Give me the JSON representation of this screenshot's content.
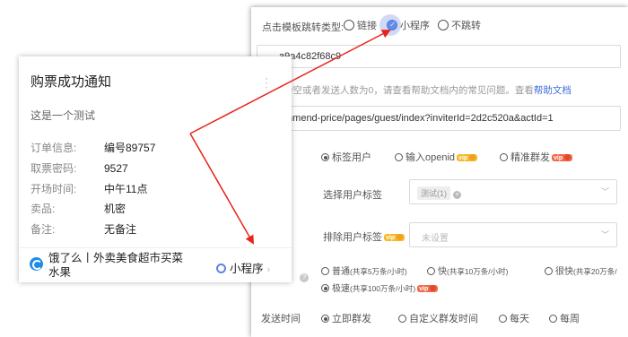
{
  "panel": {
    "jump_type": {
      "label": "点击模板跳转类型:",
      "options": [
        "链接",
        "小程序",
        "不跳转"
      ],
      "selected": "小程序"
    },
    "appid_value": "a9a4c82f68c9",
    "hint": {
      "text": "为空或者发送人数为0，请查看帮助文档内的常见问题。查看",
      "link": "帮助文档"
    },
    "path_value": "mmend-price/pages/guest/index?inviterId=2d2c520a&actId=1",
    "target_type": {
      "options": [
        "标签用户",
        "输入openid",
        "精准群发"
      ],
      "selected": "标签用户"
    },
    "select_tag": {
      "label": "选择用户标签",
      "chip": "测试(1)"
    },
    "exclude_tag": {
      "label": "排除用户标签",
      "placeholder": "未设置"
    },
    "speed": {
      "options": [
        {
          "label": "普通",
          "note": "(共享5万条/小时)"
        },
        {
          "label": "快",
          "note": "(共享10万条/小时)"
        },
        {
          "label": "很快",
          "note": "(共享20万条/"
        },
        {
          "label": "极速",
          "note": "(共享100万条/小时)"
        }
      ],
      "selected": "极速"
    },
    "send_time": {
      "label": "发送时间",
      "options": [
        "立即群发",
        "自定义群发时间",
        "每天",
        "每周"
      ],
      "selected": "立即群发"
    },
    "vip_badge": "vip"
  },
  "card": {
    "title": "购票成功通知",
    "description": "这是一个测试",
    "fields": [
      {
        "key": "订单信息:",
        "value": "编号89757"
      },
      {
        "key": "取票密码:",
        "value": "9527"
      },
      {
        "key": "开场时间:",
        "value": "中午11点"
      },
      {
        "key": "卖品:",
        "value": "机密"
      },
      {
        "key": "备注:",
        "value": "无备注"
      }
    ],
    "footer": {
      "app_name": "饿了么丨外卖美食超市买菜水果",
      "mini_program": "小程序"
    }
  },
  "colors": {
    "arrow": "#e8231b",
    "accent": "#3b6fd8",
    "vip": "#f5b826"
  }
}
